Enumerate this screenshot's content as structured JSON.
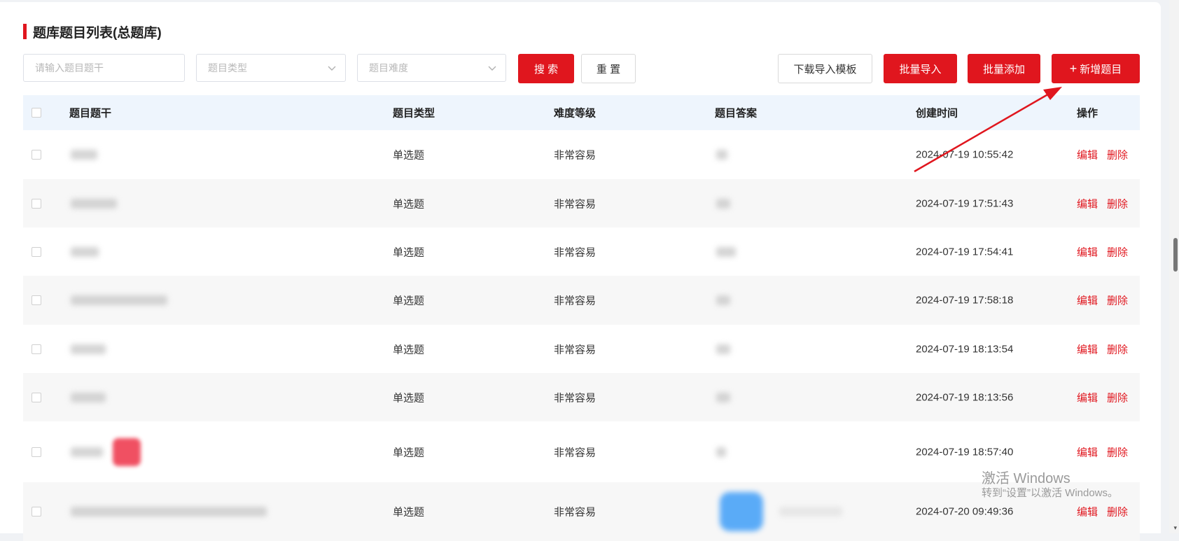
{
  "page": {
    "title": "题库题目列表(总题库)"
  },
  "filters": {
    "stem_placeholder": "请输入题目题干",
    "type_placeholder": "题目类型",
    "difficulty_placeholder": "题目难度"
  },
  "toolbar": {
    "search_label": "搜 索",
    "reset_label": "重 置",
    "download_template_label": "下载导入模板",
    "batch_import_label": "批量导入",
    "batch_add_label": "批量添加",
    "add_question_label": "新增题目"
  },
  "table": {
    "columns": [
      "题目题干",
      "题目类型",
      "难度等级",
      "题目答案",
      "创建时间",
      "操作"
    ],
    "rows": [
      {
        "type": "单选题",
        "difficulty": "非常容易",
        "created": "2024-07-19 10:55:42"
      },
      {
        "type": "单选题",
        "difficulty": "非常容易",
        "created": "2024-07-19 17:51:43"
      },
      {
        "type": "单选题",
        "difficulty": "非常容易",
        "created": "2024-07-19 17:54:41"
      },
      {
        "type": "单选题",
        "difficulty": "非常容易",
        "created": "2024-07-19 17:58:18"
      },
      {
        "type": "单选题",
        "difficulty": "非常容易",
        "created": "2024-07-19 18:13:54"
      },
      {
        "type": "单选题",
        "difficulty": "非常容易",
        "created": "2024-07-19 18:13:56"
      },
      {
        "type": "单选题",
        "difficulty": "非常容易",
        "created": "2024-07-19 18:57:40"
      },
      {
        "type": "单选题",
        "difficulty": "非常容易",
        "created": "2024-07-20 09:49:36"
      }
    ],
    "edit_label": "编辑",
    "delete_label": "删除"
  },
  "watermark": {
    "line1": "激活 Windows",
    "line2": "转到“设置”以激活 Windows。"
  },
  "colors": {
    "accent": "#e0161e",
    "header_bg": "#eef5fd",
    "stripe_bg": "#f7f7f7"
  },
  "icons": {
    "select_chevron": "chevron-down-icon",
    "add": "plus-icon",
    "annotation": "red-arrow-annotation"
  }
}
